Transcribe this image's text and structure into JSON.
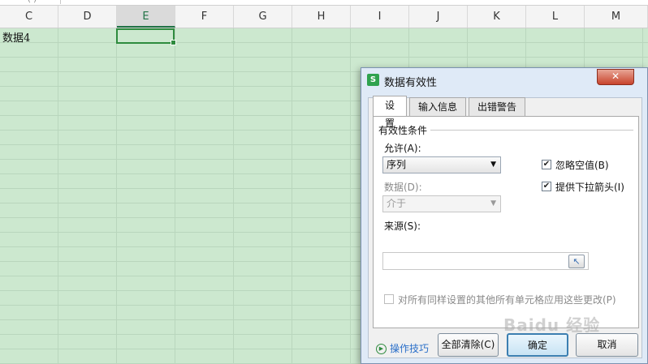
{
  "columns": [
    "C",
    "D",
    "E",
    "F",
    "G",
    "H",
    "I",
    "J",
    "K",
    "L",
    "M"
  ],
  "selected_column": "E",
  "cells": {
    "C1": "数据4"
  },
  "dialog": {
    "title": "数据有效性",
    "close_glyph": "✕",
    "app_icon_letter": "S",
    "tabs": [
      "设置",
      "输入信息",
      "出错警告"
    ],
    "active_tab": "设置",
    "group_title": "有效性条件",
    "allow_label": "允许(A):",
    "allow_value": "序列",
    "data_label": "数据(D):",
    "data_value": "介于",
    "source_label": "来源(S):",
    "source_value": "",
    "ignore_blank_label": "忽略空值(B)",
    "ignore_blank_checked": true,
    "dropdown_arrow_label": "提供下拉箭头(I)",
    "dropdown_arrow_checked": true,
    "apply_all_label": "对所有同样设置的其他所有单元格应用这些更改(P)",
    "apply_all_checked": false,
    "tips_label": "操作技巧",
    "clear_all_label": "全部清除(C)",
    "ok_label": "确定",
    "cancel_label": "取消"
  },
  "watermark": "Baidu 经验",
  "colors": {
    "grid_background": "#cce8cf",
    "selection": "#2e8b3e",
    "link": "#2a6fc9"
  }
}
